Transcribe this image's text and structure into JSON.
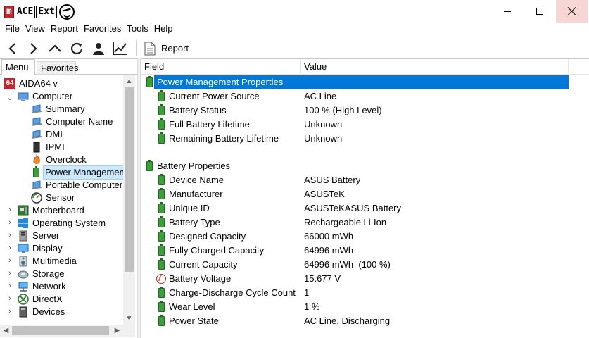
{
  "window": {
    "logo_text": [
      "m",
      "ACE",
      "Ext"
    ]
  },
  "menubar": [
    "File",
    "View",
    "Report",
    "Favorites",
    "Tools",
    "Help"
  ],
  "toolbar": {
    "report_label": "Report"
  },
  "tabs": {
    "menu": "Menu",
    "favorites": "Favorites"
  },
  "tree": {
    "root": "AIDA64 v",
    "root_badge": "64",
    "computer": "Computer",
    "summary": "Summary",
    "computer_name": "Computer Name",
    "dmi": "DMI",
    "ipmi": "IPMI",
    "overclock": "Overclock",
    "power_management": "Power Management",
    "portable_computer": "Portable Computer",
    "sensor": "Sensor",
    "motherboard": "Motherboard",
    "operating_system": "Operating System",
    "server": "Server",
    "display": "Display",
    "multimedia": "Multimedia",
    "storage": "Storage",
    "network": "Network",
    "directx": "DirectX",
    "devices": "Devices"
  },
  "columns": {
    "field": "Field",
    "value": "Value"
  },
  "groups": {
    "power_props": "Power Management Properties",
    "battery_props": "Battery Properties"
  },
  "power_rows": [
    {
      "field": "Current Power Source",
      "value": "AC Line"
    },
    {
      "field": "Battery Status",
      "value": "100 % (High Level)"
    },
    {
      "field": "Full Battery Lifetime",
      "value": "Unknown"
    },
    {
      "field": "Remaining Battery Lifetime",
      "value": "Unknown"
    }
  ],
  "battery_rows": [
    {
      "field": "Device Name",
      "value": "ASUS Battery"
    },
    {
      "field": "Manufacturer",
      "value": "ASUSTeK"
    },
    {
      "field": "Unique ID",
      "value": "ASUSTeKASUS Battery"
    },
    {
      "field": "Battery Type",
      "value": "Rechargeable Li-Ion"
    },
    {
      "field": "Designed Capacity",
      "value": "66000 mWh"
    },
    {
      "field": "Fully Charged Capacity",
      "value": "64996 mWh"
    },
    {
      "field": "Current Capacity",
      "value": "64996 mWh  (100 %)"
    },
    {
      "field": "Battery Voltage",
      "value": "15.677 V"
    },
    {
      "field": "Charge-Discharge Cycle Count",
      "value": "1"
    },
    {
      "field": "Wear Level",
      "value": "1 %"
    },
    {
      "field": "Power State",
      "value": "AC Line, Discharging"
    }
  ],
  "colors": {
    "selection": "#0078d7",
    "tree_selection": "#cce8ff",
    "battery_green": "#3aa03a",
    "close_hover": "#f7d6d6"
  }
}
